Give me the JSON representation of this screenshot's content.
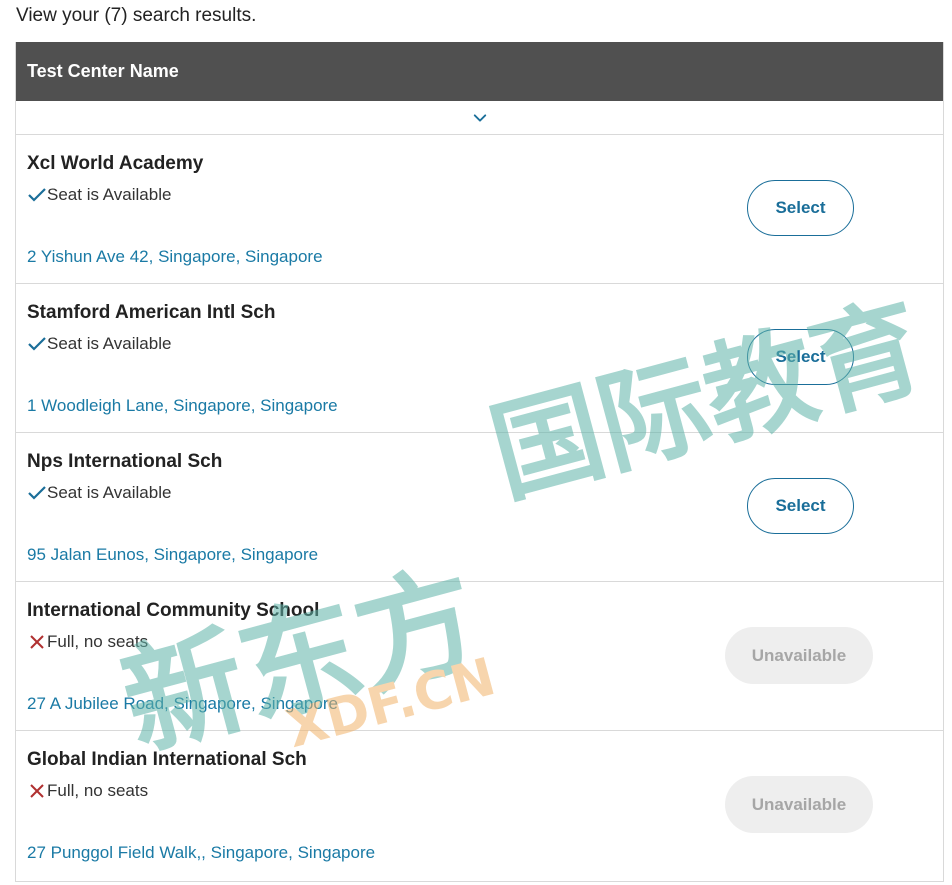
{
  "heading": "View your (7) search results.",
  "table": {
    "header": "Test Center Name",
    "sort_icon": "chevron-down-icon"
  },
  "rows": [
    {
      "name": "Xcl World Academy",
      "status": "Seat is Available",
      "available": true,
      "address": "2 Yishun Ave 42, Singapore, Singapore",
      "button": "Select"
    },
    {
      "name": "Stamford American Intl Sch",
      "status": "Seat is Available",
      "available": true,
      "address": "1 Woodleigh Lane, Singapore, Singapore",
      "button": "Select"
    },
    {
      "name": "Nps International Sch",
      "status": "Seat is Available",
      "available": true,
      "address": "95 Jalan Eunos, Singapore, Singapore",
      "button": "Select"
    },
    {
      "name": "International Community School",
      "status": "Full, no seats",
      "available": false,
      "address": "27 A Jubilee Road, Singapore, Singapore",
      "button": "Unavailable"
    },
    {
      "name": "Global Indian International Sch",
      "status": "Full, no seats",
      "available": false,
      "address": "27 Punggol Field Walk,, Singapore, Singapore",
      "button": "Unavailable"
    }
  ],
  "watermark": {
    "brand": "新东方",
    "domain": "XDF.CN",
    "tagline": "国际教育"
  },
  "colors": {
    "header_bg": "#505050",
    "link": "#1a7aa5",
    "button_outline": "#1a6e99",
    "check": "#1a6e99",
    "cross": "#b03030",
    "unavailable_bg": "#eeeeee",
    "unavailable_text": "#a6a6a6",
    "watermark_teal": "#5fb3a8",
    "watermark_orange": "#f2b36b"
  }
}
